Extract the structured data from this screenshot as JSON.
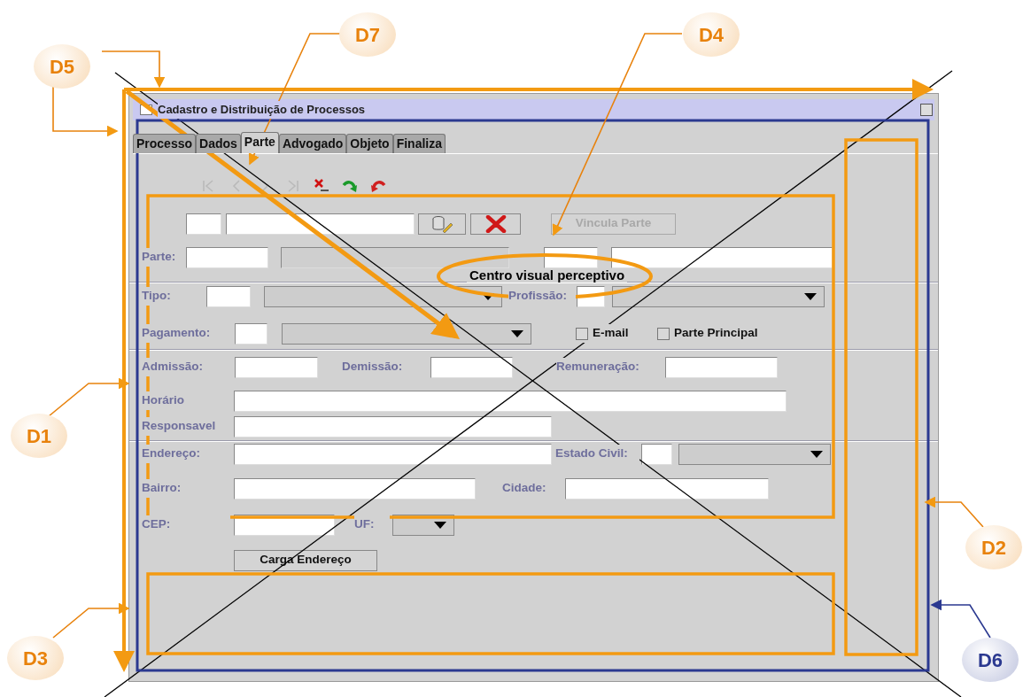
{
  "window": {
    "title": "Cadastro e Distribuição de Processos"
  },
  "tabs": [
    {
      "label": "Processo",
      "selected": false
    },
    {
      "label": "Dados",
      "selected": false
    },
    {
      "label": "Parte",
      "selected": true
    },
    {
      "label": "Advogado",
      "selected": false
    },
    {
      "label": "Objeto",
      "selected": false
    },
    {
      "label": "Finaliza",
      "selected": false
    }
  ],
  "toolbar": [
    {
      "kind": "first",
      "disabled": true
    },
    {
      "kind": "previous",
      "disabled": true
    },
    {
      "kind": "next",
      "disabled": true
    },
    {
      "kind": "last",
      "disabled": true
    },
    {
      "kind": "delete",
      "disabled": false
    },
    {
      "kind": "redo",
      "disabled": false
    },
    {
      "kind": "undo",
      "disabled": false
    }
  ],
  "form": [
    {
      "kind": "fields",
      "items": [
        {
          "kind": "input"
        },
        {
          "kind": "input"
        },
        {
          "kind": "lookup"
        },
        {
          "kind": "clear"
        },
        {
          "kind": "button",
          "text": "Vincula Parte",
          "disabled": true
        }
      ]
    },
    {
      "kind": "fields",
      "items": [
        {
          "kind": "label",
          "text": "Parte:"
        },
        {
          "kind": "input"
        },
        {
          "kind": "input",
          "disabled": true
        },
        {
          "kind": "input"
        },
        {
          "kind": "input"
        }
      ]
    },
    {
      "kind": "separator"
    },
    {
      "kind": "fields",
      "items": [
        {
          "kind": "label",
          "text": "Tipo:"
        },
        {
          "kind": "input"
        },
        {
          "kind": "combo"
        },
        {
          "kind": "label",
          "text": "Profissão:"
        },
        {
          "kind": "input"
        },
        {
          "kind": "combo"
        }
      ]
    },
    {
      "kind": "fields",
      "items": [
        {
          "kind": "label",
          "text": "Pagamento:"
        },
        {
          "kind": "input"
        },
        {
          "kind": "combo"
        },
        {
          "kind": "checkbox",
          "text": "E-mail",
          "checked": false
        },
        {
          "kind": "checkbox",
          "text": "Parte Principal",
          "checked": false
        }
      ]
    },
    {
      "kind": "separator"
    },
    {
      "kind": "fields",
      "items": [
        {
          "kind": "label",
          "text": "Admissão:"
        },
        {
          "kind": "input"
        },
        {
          "kind": "label",
          "text": "Demissão:"
        },
        {
          "kind": "input"
        },
        {
          "kind": "label",
          "text": "Remuneração:"
        },
        {
          "kind": "input"
        }
      ]
    },
    {
      "kind": "fields",
      "items": [
        {
          "kind": "label",
          "text": "Horário"
        },
        {
          "kind": "input"
        }
      ]
    },
    {
      "kind": "fields",
      "items": [
        {
          "kind": "label",
          "text": "Responsavel"
        },
        {
          "kind": "input"
        }
      ]
    },
    {
      "kind": "separator"
    },
    {
      "kind": "fields",
      "items": [
        {
          "kind": "label",
          "text": "Endereço:"
        },
        {
          "kind": "input"
        },
        {
          "kind": "label",
          "text": "Estado Civil:"
        },
        {
          "kind": "input"
        },
        {
          "kind": "combo"
        }
      ]
    },
    {
      "kind": "fields",
      "items": [
        {
          "kind": "label",
          "text": "Bairro:"
        },
        {
          "kind": "input"
        },
        {
          "kind": "label",
          "text": "Cidade:"
        },
        {
          "kind": "input"
        }
      ]
    },
    {
      "kind": "fields",
      "items": [
        {
          "kind": "label",
          "text": "CEP:"
        },
        {
          "kind": "input"
        },
        {
          "kind": "label",
          "text": "UF:"
        },
        {
          "kind": "combo"
        }
      ]
    },
    {
      "kind": "fields",
      "items": [
        {
          "kind": "button",
          "text": "Carga Endereço",
          "disabled": false
        }
      ]
    }
  ],
  "annotations": {
    "focus_label": "Centro visual perceptivo",
    "callouts": [
      {
        "label": "D5",
        "color": "#e8820c"
      },
      {
        "label": "D7",
        "color": "#e8820c"
      },
      {
        "label": "D4",
        "color": "#e8820c"
      },
      {
        "label": "D1",
        "color": "#e8820c"
      },
      {
        "label": "D2",
        "color": "#e8820c"
      },
      {
        "label": "D3",
        "color": "#e8820c"
      },
      {
        "label": "D6",
        "color": "#2b3990"
      }
    ]
  }
}
